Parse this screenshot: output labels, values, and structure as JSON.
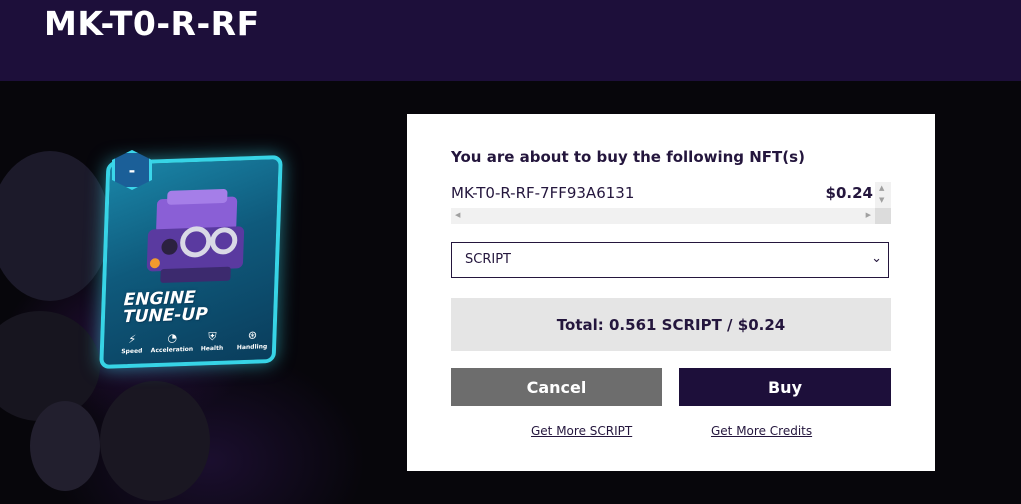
{
  "header": {
    "title": "MK-T0-R-RF"
  },
  "card": {
    "badge": "-",
    "name_line1": "ENGINE",
    "name_line2": "TUNE-UP",
    "stats": [
      {
        "icon": "lightning-icon",
        "label": "Speed"
      },
      {
        "icon": "gauge-icon",
        "label": "Acceleration"
      },
      {
        "icon": "shield-health-icon",
        "label": "Health"
      },
      {
        "icon": "steering-wheel-icon",
        "label": "Handling"
      }
    ]
  },
  "modal": {
    "heading": "You are about to buy the following NFT(s)",
    "items": [
      {
        "name": "MK-T0-R-RF-7FF93A6131",
        "price": "$0.24"
      }
    ],
    "currency_selected": "SCRIPT",
    "total": "Total: 0.561 SCRIPT / $0.24",
    "cancel_label": "Cancel",
    "buy_label": "Buy",
    "link_script": "Get More SCRIPT",
    "link_credits": "Get More Credits"
  },
  "colors": {
    "header_bg": "#1d0f3a",
    "buy_button": "#1d0f3a",
    "cancel_button": "#6d6d6d",
    "card_glow": "#37d4e6"
  }
}
